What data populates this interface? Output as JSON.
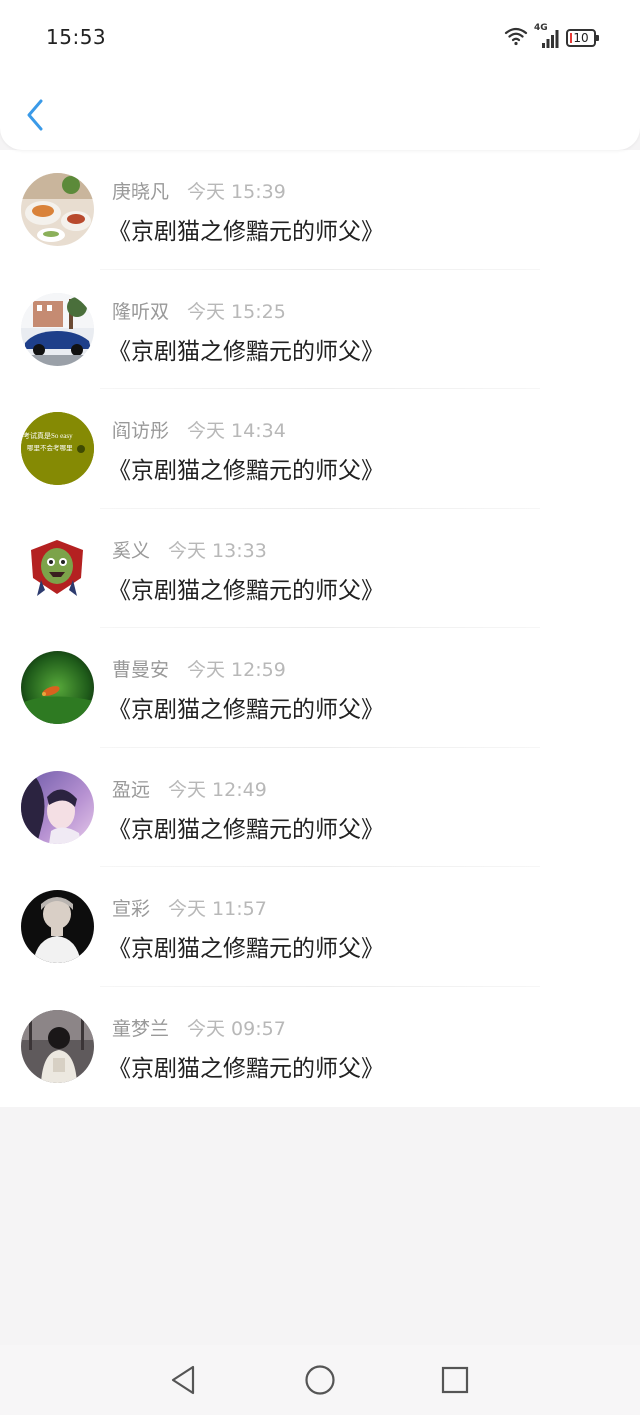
{
  "status_bar": {
    "time": "15:53",
    "network": "4G",
    "battery": "10",
    "battery_level": 0.1
  },
  "header": {
    "back_icon": "chevron-left-icon"
  },
  "list": {
    "items": [
      {
        "name": "庚晓凡",
        "time": "今天 15:39",
        "message": "《京剧猫之修黯元的师父》",
        "avatar": "food-photo"
      },
      {
        "name": "隆听双",
        "time": "今天 15:25",
        "message": "《京剧猫之修黯元的师父》",
        "avatar": "blue-car-photo"
      },
      {
        "name": "阎访彤",
        "time": "今天 14:34",
        "message": "《京剧猫之修黯元的师父》",
        "avatar": "olive-text-image"
      },
      {
        "name": "奚义",
        "time": "今天 13:33",
        "message": "《京剧猫之修黯元的师父》",
        "avatar": "cartoon-monster-image"
      },
      {
        "name": "曹曼安",
        "time": "今天 12:59",
        "message": "《京剧猫之修黯元的师父》",
        "avatar": "green-leaf-photo"
      },
      {
        "name": "盈远",
        "time": "今天 12:49",
        "message": "《京剧猫之修黯元的师父》",
        "avatar": "anime-girl-image"
      },
      {
        "name": "宣彩",
        "time": "今天 11:57",
        "message": "《京剧猫之修黯元的师父》",
        "avatar": "portrait-photo"
      },
      {
        "name": "童梦兰",
        "time": "今天 09:57",
        "message": "《京剧猫之修黯元的师父》",
        "avatar": "person-back-photo"
      }
    ]
  },
  "avatar_text": {
    "line1": "考试真是So easy",
    "line2": "哪里不会考哪里"
  },
  "nav_bar": {
    "back": "triangle-back-icon",
    "home": "circle-home-icon",
    "recents": "square-recents-icon"
  },
  "colors": {
    "accent": "#3a9ae8",
    "name": "#999999",
    "time": "#b8b8b8",
    "message": "#222222",
    "background": "#f5f4f5"
  }
}
